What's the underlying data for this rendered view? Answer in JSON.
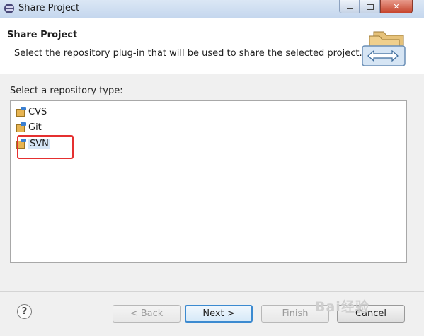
{
  "window": {
    "title": "Share Project"
  },
  "header": {
    "title": "Share Project",
    "description": "Select the repository plug-in that will be used to share the selected project."
  },
  "repository": {
    "label": "Select a repository type:",
    "items": [
      {
        "label": "CVS"
      },
      {
        "label": "Git"
      },
      {
        "label": "SVN",
        "selected": true
      }
    ]
  },
  "footer": {
    "help_label": "?",
    "back_label": "< Back",
    "next_label": "Next >",
    "finish_label": "Finish",
    "cancel_label": "Cancel"
  },
  "watermark": "Bai经验",
  "colors": {
    "highlight": "#e53030",
    "selection": "#d5e6f7",
    "default_button_border": "#3c8ad0"
  }
}
